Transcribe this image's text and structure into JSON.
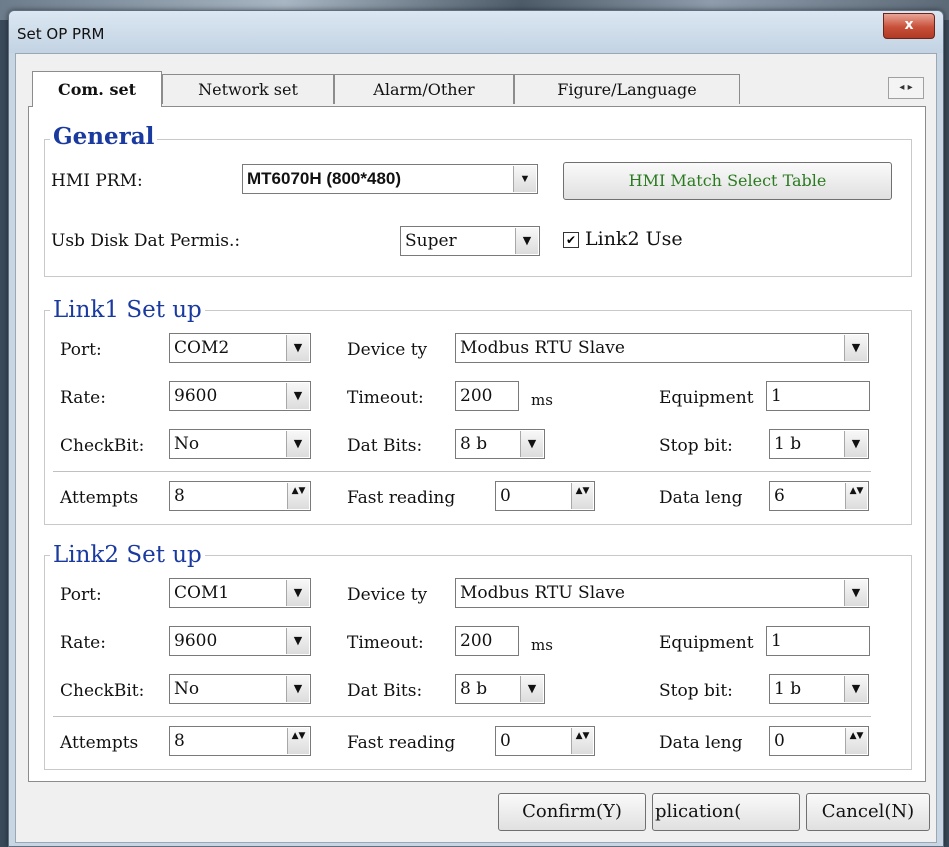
{
  "window": {
    "title": "Set OP PRM",
    "close_label": "x"
  },
  "tabs": [
    "Com. set",
    "Network set",
    "Alarm/Other",
    "Figure/Language"
  ],
  "tab_scroll": {
    "left": "◂",
    "right": "▸"
  },
  "general": {
    "title": "General",
    "hmi_prm_label": "HMI PRM:",
    "hmi_prm_value": "MT6070H (800*480)",
    "match_button": "HMI Match Select Table",
    "usb_label": "Usb Disk Dat Permis.:",
    "usb_value": "Super",
    "link2_use_label": "Link2 Use",
    "link2_use_checked": true
  },
  "link1": {
    "title": "Link1 Set up",
    "port_label": "Port:",
    "port_value": "COM2",
    "device_label": "Device ty",
    "device_value": "Modbus RTU Slave",
    "rate_label": "Rate:",
    "rate_value": "9600",
    "timeout_label": "Timeout:",
    "timeout_value": "200",
    "timeout_unit": "ms",
    "equipment_label": "Equipment",
    "equipment_value": "1",
    "checkbit_label": "CheckBit:",
    "checkbit_value": "No",
    "datbits_label": "Dat Bits:",
    "datbits_value": "8 b",
    "stopbit_label": "Stop bit:",
    "stopbit_value": "1 b",
    "attempts_label": "Attempts",
    "attempts_value": "8",
    "fast_label": "Fast reading",
    "fast_value": "0",
    "datalen_label": "Data leng",
    "datalen_value": "6"
  },
  "link2": {
    "title": "Link2 Set up",
    "port_label": "Port:",
    "port_value": "COM1",
    "device_label": "Device ty",
    "device_value": "Modbus RTU Slave",
    "rate_label": "Rate:",
    "rate_value": "9600",
    "timeout_label": "Timeout:",
    "timeout_value": "200",
    "timeout_unit": "ms",
    "equipment_label": "Equipment",
    "equipment_value": "1",
    "checkbit_label": "CheckBit:",
    "checkbit_value": "No",
    "datbits_label": "Dat Bits:",
    "datbits_value": "8 b",
    "stopbit_label": "Stop bit:",
    "stopbit_value": "1 b",
    "attempts_label": "Attempts",
    "attempts_value": "8",
    "fast_label": "Fast reading",
    "fast_value": "0",
    "datalen_label": "Data leng",
    "datalen_value": "0"
  },
  "buttons": {
    "confirm": "Confirm(Y)",
    "application": "plication(",
    "cancel": "Cancel(N)"
  },
  "icons": {
    "dropdown": "▼",
    "spin": "▲▼",
    "check": "✔"
  }
}
